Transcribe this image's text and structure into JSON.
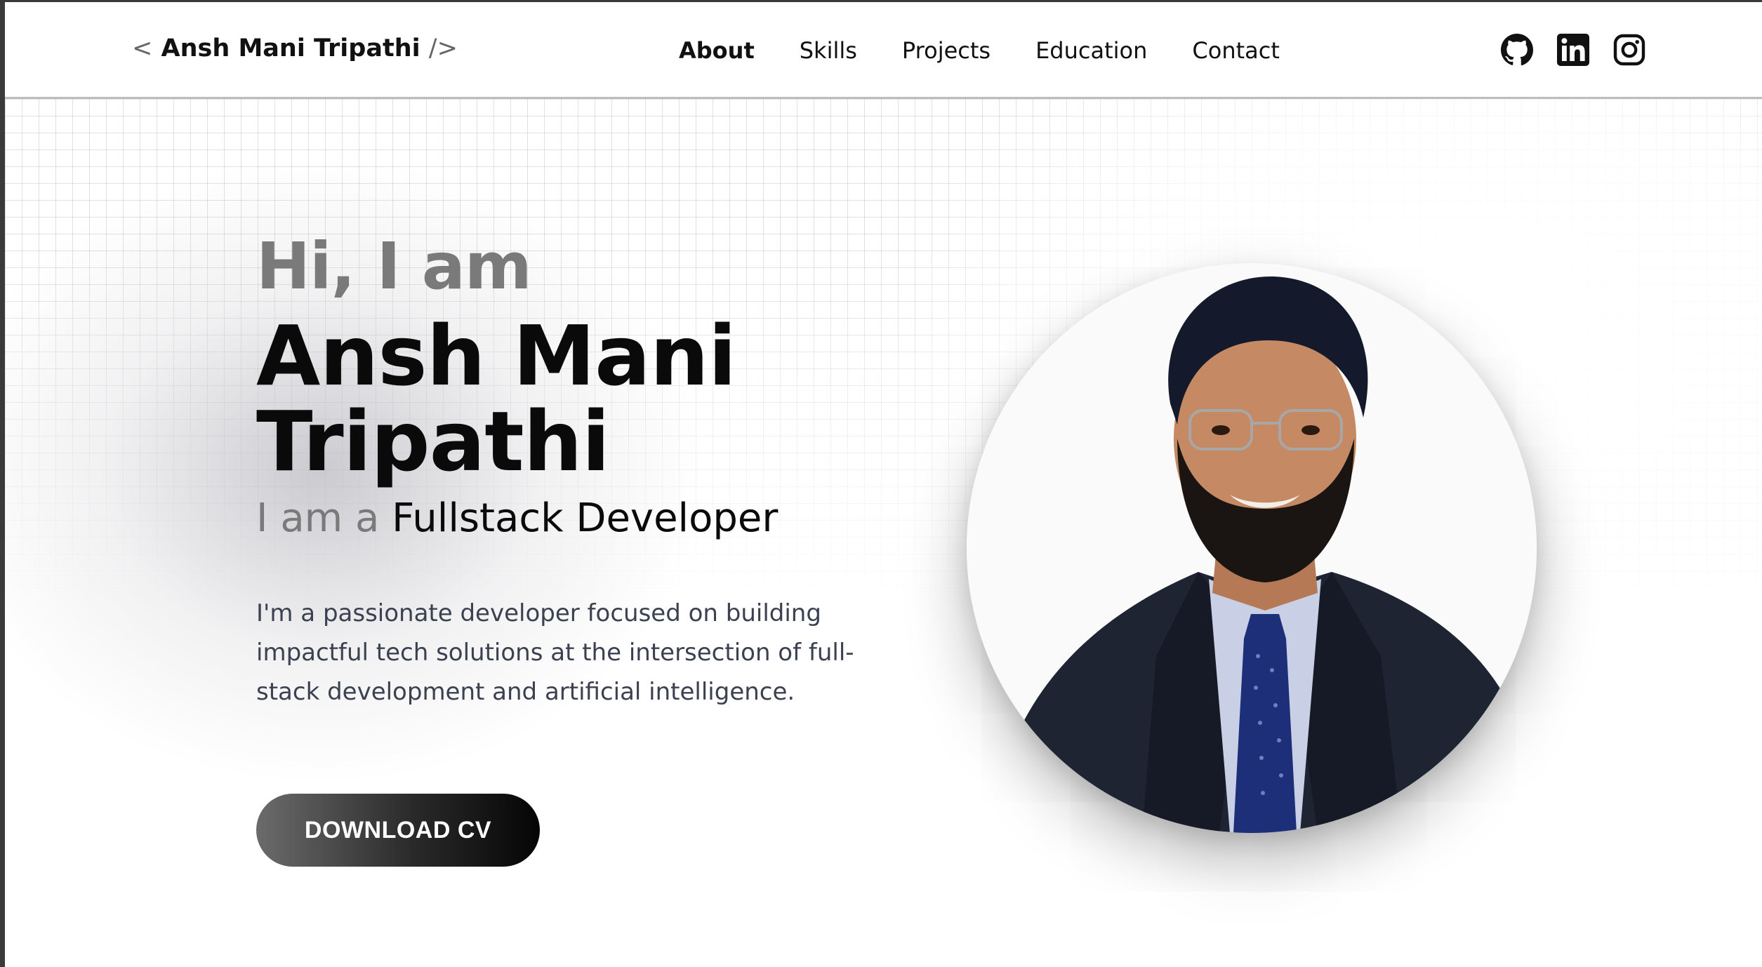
{
  "header": {
    "logo": {
      "open": "<",
      "name": "Ansh Mani Tripathi",
      "close": "/>"
    },
    "nav": [
      {
        "label": "About",
        "active": true
      },
      {
        "label": "Skills",
        "active": false
      },
      {
        "label": "Projects",
        "active": false
      },
      {
        "label": "Education",
        "active": false
      },
      {
        "label": "Contact",
        "active": false
      }
    ],
    "socials": [
      "github-icon",
      "linkedin-icon",
      "instagram-icon"
    ]
  },
  "hero": {
    "greeting": "Hi, I am",
    "name_line1": "Ansh Mani",
    "name_line2": "Tripathi",
    "role_prefix": "I am a",
    "role_title": "Fullstack Developer",
    "bio": "I'm a passionate developer focused on building impactful tech solutions at the intersection of full-stack development and artificial intelligence.",
    "cta_label": "DOWNLOAD CV"
  },
  "colors": {
    "text_primary": "#0a0a0a",
    "text_muted": "#7a7a7a",
    "bio_text": "#3b4150",
    "button_dark": "#050505"
  }
}
